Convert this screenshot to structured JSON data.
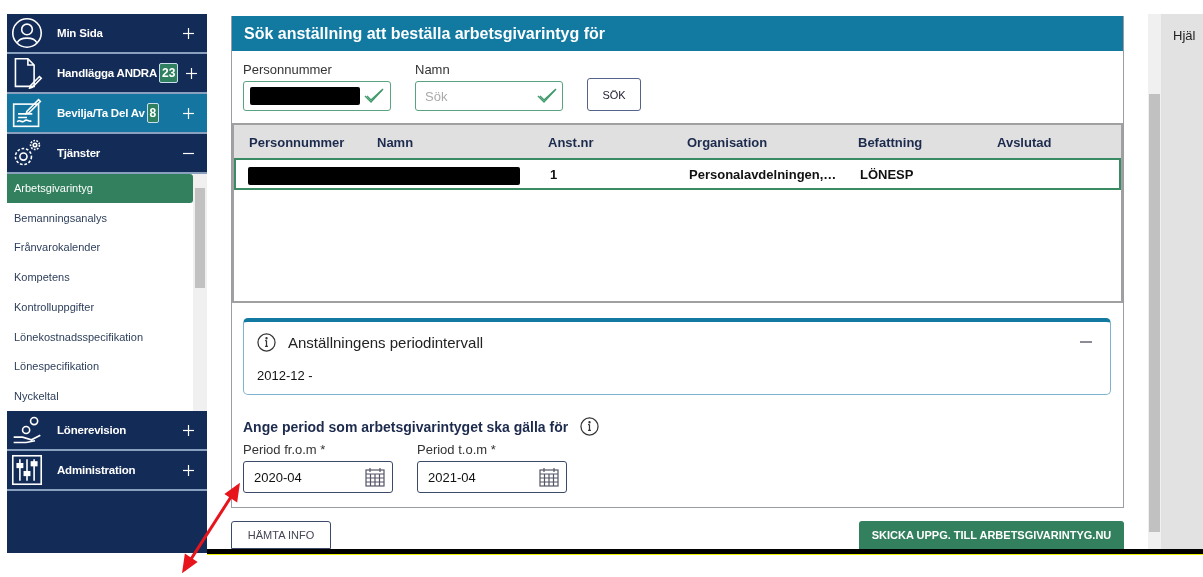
{
  "sidebar": {
    "items": [
      {
        "label": "Min Sida",
        "selected": false,
        "expanded": false
      },
      {
        "label": "Handlägga ANDRA",
        "badge": "23",
        "selected": false,
        "expanded": false
      },
      {
        "label": "Bevilja/Ta Del Av",
        "badge": "8",
        "selected": true,
        "expanded": false
      },
      {
        "label": "Tjänster",
        "selected": false,
        "expanded": true,
        "children": [
          {
            "label": "Arbetsgivarintyg",
            "selected": true
          },
          {
            "label": "Bemanningsanalys",
            "selected": false
          },
          {
            "label": "Frånvarokalender",
            "selected": false
          },
          {
            "label": "Kompetens",
            "selected": false
          },
          {
            "label": "Kontrolluppgifter",
            "selected": false
          },
          {
            "label": "Lönekostnadsspecifikation",
            "selected": false
          },
          {
            "label": "Lönespecifikation",
            "selected": false
          },
          {
            "label": "Nyckeltal",
            "selected": false
          }
        ]
      },
      {
        "label": "Lönerevision",
        "selected": false,
        "expanded": false
      },
      {
        "label": "Administration",
        "selected": false,
        "expanded": false
      }
    ]
  },
  "main": {
    "title": "Sök anställning att beställa arbetsgivarintyg för",
    "search": {
      "fields": [
        {
          "label": "Personnummer"
        },
        {
          "label": "Namn",
          "placeholder": "Sök"
        }
      ],
      "button": "SÖK"
    },
    "table": {
      "columns": [
        "Personnummer",
        "Namn",
        "Anst.nr",
        "Organisation",
        "Befattning",
        "Avslutad"
      ],
      "rows": [
        {
          "selected": true,
          "cells": [
            "",
            "",
            "1",
            "Personalavdelningen,…",
            "LÖNESP",
            ""
          ]
        }
      ]
    },
    "interval": {
      "title": "Anställningens periodintervall",
      "expanded": true,
      "value": "2012-12 -"
    },
    "period": {
      "heading": "Ange period som arbetsgivarintyget ska gälla för",
      "fields": [
        {
          "label": "Period fr.o.m *",
          "value": "2020-04"
        },
        {
          "label": "Period t.o.m *",
          "value": "2021-04"
        }
      ]
    },
    "buttons": [
      {
        "label": "HÄMTA INFO",
        "kind": "secondary"
      },
      {
        "label": "SKICKA UPPG. TILL ARBETSGIVARINTYG.NU",
        "kind": "primary"
      }
    ]
  },
  "help": {
    "title": "Hjäl"
  }
}
